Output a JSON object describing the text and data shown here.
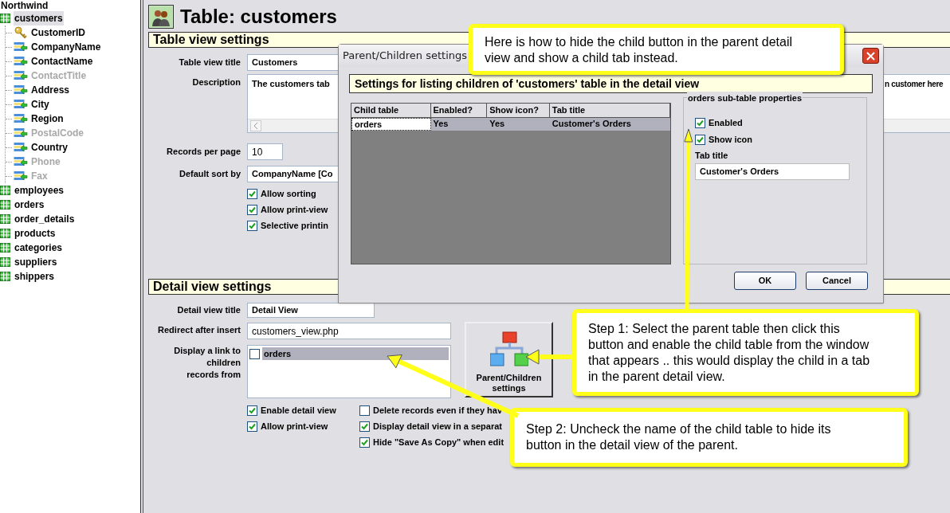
{
  "tree": {
    "root": "Northwind",
    "tables": [
      {
        "name": "customers",
        "selected": true,
        "children": [
          {
            "name": "CustomerID",
            "kind": "key",
            "dimmed": false
          },
          {
            "name": "CompanyName",
            "kind": "field",
            "dimmed": false
          },
          {
            "name": "ContactName",
            "kind": "field",
            "dimmed": false
          },
          {
            "name": "ContactTitle",
            "kind": "field",
            "dimmed": true
          },
          {
            "name": "Address",
            "kind": "field",
            "dimmed": false
          },
          {
            "name": "City",
            "kind": "field",
            "dimmed": false
          },
          {
            "name": "Region",
            "kind": "field",
            "dimmed": false
          },
          {
            "name": "PostalCode",
            "kind": "field",
            "dimmed": true
          },
          {
            "name": "Country",
            "kind": "field",
            "dimmed": false
          },
          {
            "name": "Phone",
            "kind": "field",
            "dimmed": true
          },
          {
            "name": "Fax",
            "kind": "field",
            "dimmed": true
          }
        ]
      },
      {
        "name": "employees",
        "selected": false
      },
      {
        "name": "orders",
        "selected": false
      },
      {
        "name": "order_details",
        "selected": false
      },
      {
        "name": "products",
        "selected": false
      },
      {
        "name": "categories",
        "selected": false
      },
      {
        "name": "suppliers",
        "selected": false
      },
      {
        "name": "shippers",
        "selected": false
      }
    ]
  },
  "page_title": "Table: customers",
  "table_view": {
    "heading": "Table view settings",
    "fields": [
      {
        "kind": "text",
        "label": "Table view title",
        "value": "Customers"
      },
      {
        "kind": "textarea",
        "label": "Description",
        "value": "The customers tab",
        "value_tail": "n customer here"
      },
      {
        "kind": "short",
        "label": "Records per page",
        "value": "10"
      },
      {
        "kind": "select",
        "label": "Default sort by",
        "value": "CompanyName [Co"
      }
    ],
    "options": [
      {
        "label": "Allow sorting",
        "checked": true
      },
      {
        "label": "Allow print-view",
        "checked": true
      },
      {
        "label": "Selective printin",
        "checked": true
      }
    ]
  },
  "detail_view": {
    "heading": "Detail view settings",
    "fields": [
      {
        "kind": "short",
        "label": "Detail view title",
        "value": "Detail View"
      },
      {
        "kind": "text",
        "label": "Redirect after insert",
        "value": "customers_view.php"
      },
      {
        "kind": "list",
        "label": "Display a link to children records from",
        "items": [
          {
            "label": "orders",
            "checked": false,
            "selected": true
          }
        ]
      }
    ],
    "button": "Parent/Children settings",
    "options_left": [
      {
        "label": "Enable detail view",
        "checked": true
      },
      {
        "label": "Allow print-view",
        "checked": true
      }
    ],
    "options_right": [
      {
        "label": "Delete records even if they hav",
        "checked": false
      },
      {
        "label": "Display detail view in a separat",
        "checked": true
      },
      {
        "label": "Hide \"Save As Copy\" when edit",
        "checked": true
      }
    ]
  },
  "dialog": {
    "title": "Parent/Children settings",
    "heading": "Settings for listing children of 'customers' table in the detail view",
    "columns": [
      "Child table",
      "Enabled?",
      "Show icon?",
      "Tab title"
    ],
    "rows": [
      {
        "cells": [
          "orders",
          "Yes",
          "Yes",
          "Customer's Orders"
        ],
        "selected": true
      }
    ],
    "group_title": "orders sub-table properties",
    "options": [
      {
        "label": "Enabled",
        "checked": true
      },
      {
        "label": "Show icon",
        "checked": true
      }
    ],
    "tab_title_label": "Tab title",
    "tab_title_value": "Customer's Orders",
    "buttons": [
      "OK",
      "Cancel"
    ]
  },
  "callouts": [
    {
      "text": "Here is how to hide the child button in the parent detail view and show a child tab instead."
    },
    {
      "text": "Step 1: Select the parent table then click this button and enable the child table from the window that appears .. this would display the child in a tab in the parent detail view."
    },
    {
      "text": "Step 2: Uncheck the name of the child table to hide its button in the detail view of the parent."
    }
  ]
}
